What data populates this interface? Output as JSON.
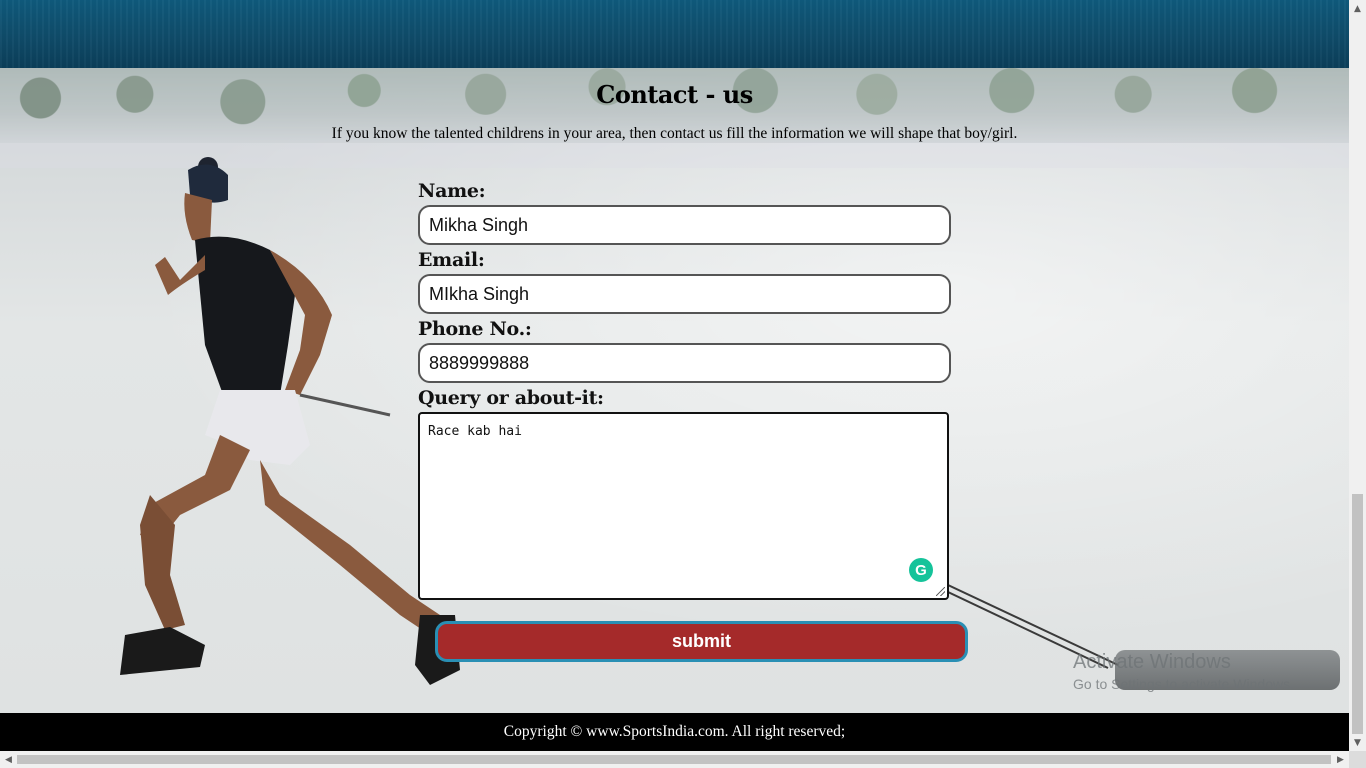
{
  "contact": {
    "title": "Contact - us",
    "subtitle": "If you know the talented childrens in your area, then contact us fill the information we will shape that boy/girl."
  },
  "form": {
    "name_label": "Name:",
    "name_value": "Mikha Singh",
    "email_label": "Email:",
    "email_value": "MIkha Singh",
    "phone_label": "Phone No.:",
    "phone_value": "8889999888",
    "query_label": "Query or about-it:",
    "query_value": "Race kab hai",
    "submit_label": "submit"
  },
  "footer": {
    "copyright": "Copyright © www.SportsIndia.com. All right reserved;"
  },
  "watermark": {
    "line1": "Activate Windows",
    "line2": "Go to Settings to activate Windows."
  },
  "colors": {
    "submit_bg": "#a52a2a",
    "submit_border": "#2a8fb4",
    "footer_bg": "#000000",
    "grammarly": "#15c39a"
  },
  "icons": {
    "grammarly": "grammarly-icon"
  }
}
